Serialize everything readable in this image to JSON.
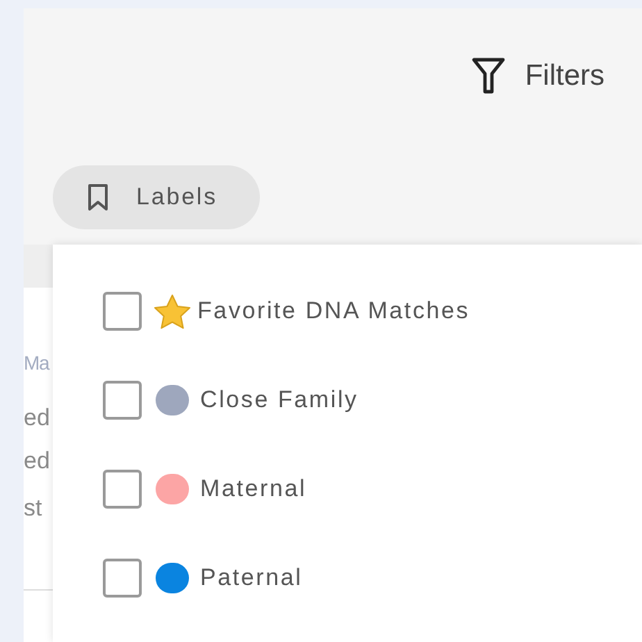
{
  "toolbar": {
    "filters_button": {
      "label": "Filters"
    },
    "labels_button": {
      "label": "Labels",
      "expanded": true
    }
  },
  "background_list": {
    "items": [
      {
        "text": "Ma"
      },
      {
        "text": "ed"
      },
      {
        "text": "ed"
      },
      {
        "text": "st"
      }
    ]
  },
  "labels_menu": {
    "items": [
      {
        "label": "Favorite DNA Matches",
        "kind": "star",
        "checked": false
      },
      {
        "label": "Close Family",
        "kind": "dot",
        "color": "#9ea7bd",
        "checked": false
      },
      {
        "label": "Maternal",
        "kind": "dot",
        "color": "#fca5a5",
        "checked": false
      },
      {
        "label": "Paternal",
        "kind": "dot",
        "color": "#0a84e0",
        "checked": false
      }
    ]
  }
}
